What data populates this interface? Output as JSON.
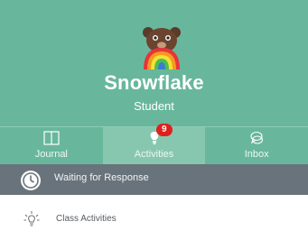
{
  "profile": {
    "name": "Snowflake",
    "role": "Student",
    "avatar": "rainbow-bear-avatar"
  },
  "tabs": [
    {
      "label": "Journal",
      "icon": "book-icon",
      "active": false
    },
    {
      "label": "Activities",
      "icon": "lightbulb-icon",
      "active": true,
      "badge": "9"
    },
    {
      "label": "Inbox",
      "icon": "chat-bubbles-icon",
      "active": false
    }
  ],
  "status": {
    "text": "Waiting for Response",
    "icon": "clock-icon"
  },
  "list": {
    "items": [
      {
        "label": "Class Activities",
        "icon": "lightbulb-icon"
      }
    ]
  },
  "colors": {
    "header": "#68b79c",
    "active_tab": "#87c7b0",
    "status_bar": "#69737b",
    "badge": "#e0201c"
  }
}
